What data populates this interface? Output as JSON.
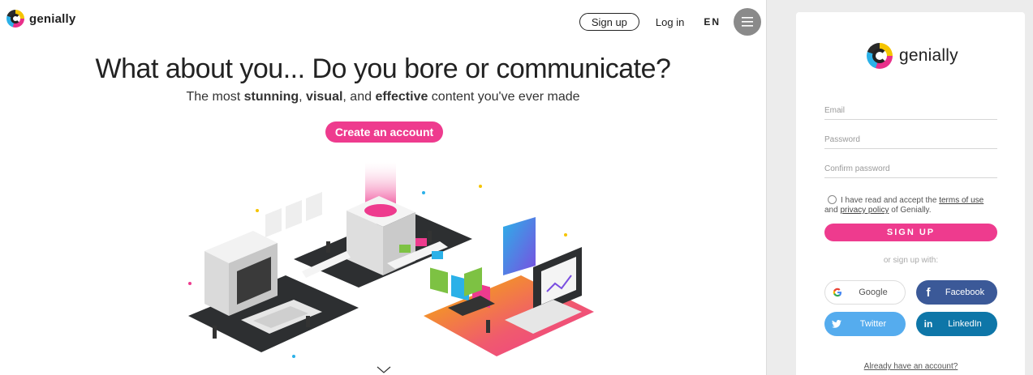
{
  "brand": {
    "name": "genially"
  },
  "topnav": {
    "signup_label": "Sign up",
    "login_label": "Log in",
    "language": "EN",
    "menu_icon": "hamburger-icon"
  },
  "hero": {
    "title": "What about you... Do you bore or communicate?",
    "subtitle_parts": [
      "The most ",
      "stunning",
      ", ",
      "visual",
      ", and ",
      "effective",
      " content you've ever made"
    ],
    "cta_label": "Create an account"
  },
  "signup": {
    "email_placeholder": "Email",
    "password_placeholder": "Password",
    "confirm_placeholder": "Confirm password",
    "terms_prefix": "I have read and accept the ",
    "terms_link": "terms of use",
    "terms_middle": "and ",
    "privacy_link": "privacy policy",
    "terms_suffix": " of Genially.",
    "button_label": "SIGN UP",
    "or_text": "or sign up with:",
    "social": {
      "google": "Google",
      "facebook": "Facebook",
      "twitter": "Twitter",
      "linkedin": "LinkedIn"
    },
    "already_label": "Already have an account?"
  },
  "colors": {
    "accent": "#ee3b8e",
    "facebook": "#3b5998",
    "twitter": "#55acee",
    "linkedin": "#0e76a8"
  }
}
